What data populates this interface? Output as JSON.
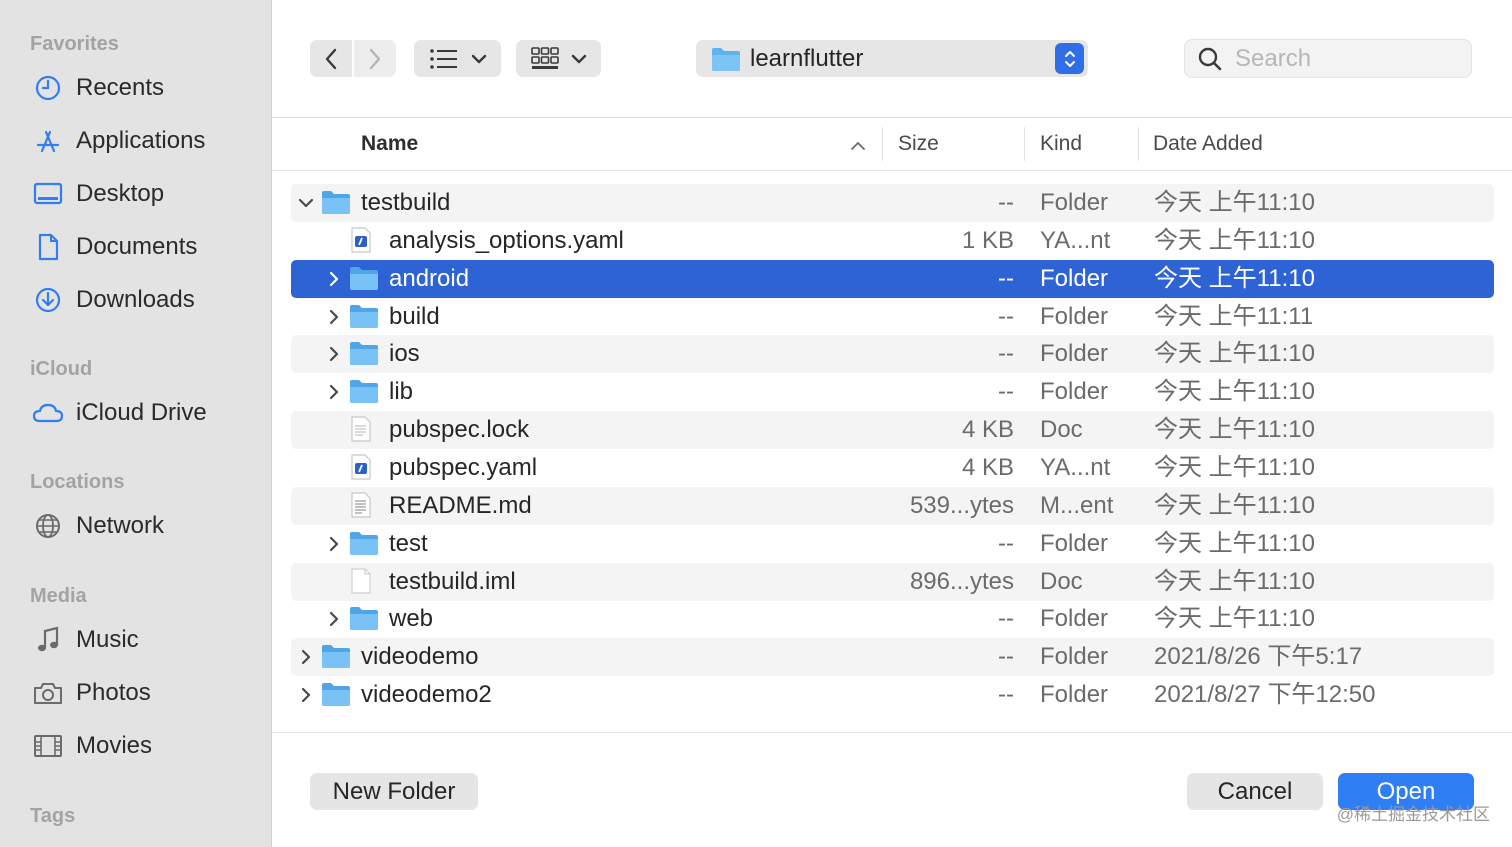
{
  "sidebar": {
    "sections": [
      {
        "title": "Favorites",
        "items": [
          {
            "label": "Recents",
            "icon": "clock-icon"
          },
          {
            "label": "Applications",
            "icon": "applications-icon"
          },
          {
            "label": "Desktop",
            "icon": "desktop-icon"
          },
          {
            "label": "Documents",
            "icon": "document-icon"
          },
          {
            "label": "Downloads",
            "icon": "download-icon"
          }
        ]
      },
      {
        "title": "iCloud",
        "items": [
          {
            "label": "iCloud Drive",
            "icon": "cloud-icon"
          }
        ]
      },
      {
        "title": "Locations",
        "items": [
          {
            "label": "Network",
            "icon": "globe-icon"
          }
        ]
      },
      {
        "title": "Media",
        "items": [
          {
            "label": "Music",
            "icon": "music-note-icon"
          },
          {
            "label": "Photos",
            "icon": "camera-icon"
          },
          {
            "label": "Movies",
            "icon": "film-icon"
          }
        ]
      },
      {
        "title": "Tags",
        "items": []
      }
    ]
  },
  "toolbar": {
    "current_folder": "learnflutter",
    "search_placeholder": "Search"
  },
  "columns": {
    "name": "Name",
    "size": "Size",
    "kind": "Kind",
    "date_added": "Date Added"
  },
  "files": [
    {
      "name": "testbuild",
      "size": "--",
      "kind": "Folder",
      "date": "今天 上午11:10",
      "type": "folder",
      "depth": 0,
      "disclosure": "expanded"
    },
    {
      "name": "analysis_options.yaml",
      "size": "1 KB",
      "kind": "YA...nt",
      "date": "今天 上午11:10",
      "type": "yaml",
      "depth": 1,
      "disclosure": "none"
    },
    {
      "name": "android",
      "size": "--",
      "kind": "Folder",
      "date": "今天 上午11:10",
      "type": "folder",
      "depth": 1,
      "disclosure": "collapsed",
      "selected": true
    },
    {
      "name": "build",
      "size": "--",
      "kind": "Folder",
      "date": "今天 上午11:11",
      "type": "folder",
      "depth": 1,
      "disclosure": "collapsed"
    },
    {
      "name": "ios",
      "size": "--",
      "kind": "Folder",
      "date": "今天 上午11:10",
      "type": "folder",
      "depth": 1,
      "disclosure": "collapsed"
    },
    {
      "name": "lib",
      "size": "--",
      "kind": "Folder",
      "date": "今天 上午11:10",
      "type": "folder",
      "depth": 1,
      "disclosure": "collapsed"
    },
    {
      "name": "pubspec.lock",
      "size": "4 KB",
      "kind": "Doc",
      "date": "今天 上午11:10",
      "type": "doc",
      "depth": 1,
      "disclosure": "none"
    },
    {
      "name": "pubspec.yaml",
      "size": "4 KB",
      "kind": "YA...nt",
      "date": "今天 上午11:10",
      "type": "yaml",
      "depth": 1,
      "disclosure": "none"
    },
    {
      "name": "README.md",
      "size": "539...ytes",
      "kind": "M...ent",
      "date": "今天 上午11:10",
      "type": "md",
      "depth": 1,
      "disclosure": "none"
    },
    {
      "name": "test",
      "size": "--",
      "kind": "Folder",
      "date": "今天 上午11:10",
      "type": "folder",
      "depth": 1,
      "disclosure": "collapsed"
    },
    {
      "name": "testbuild.iml",
      "size": "896...ytes",
      "kind": "Doc",
      "date": "今天 上午11:10",
      "type": "blank",
      "depth": 1,
      "disclosure": "none"
    },
    {
      "name": "web",
      "size": "--",
      "kind": "Folder",
      "date": "今天 上午11:10",
      "type": "folder",
      "depth": 1,
      "disclosure": "collapsed"
    },
    {
      "name": "videodemo",
      "size": "--",
      "kind": "Folder",
      "date": "2021/8/26 下午5:17",
      "type": "folder",
      "depth": 0,
      "disclosure": "collapsed"
    },
    {
      "name": "videodemo2",
      "size": "--",
      "kind": "Folder",
      "date": "2021/8/27 下午12:50",
      "type": "folder",
      "depth": 0,
      "disclosure": "collapsed"
    }
  ],
  "footer": {
    "new_folder": "New Folder",
    "cancel": "Cancel",
    "open": "Open"
  },
  "watermark": "@稀土掘金技术社区",
  "colors": {
    "accent": "#2f7ef3",
    "selection": "#2e63d6",
    "folder": "#5db2f0",
    "sidebar_icon": "#2f7ef3"
  }
}
